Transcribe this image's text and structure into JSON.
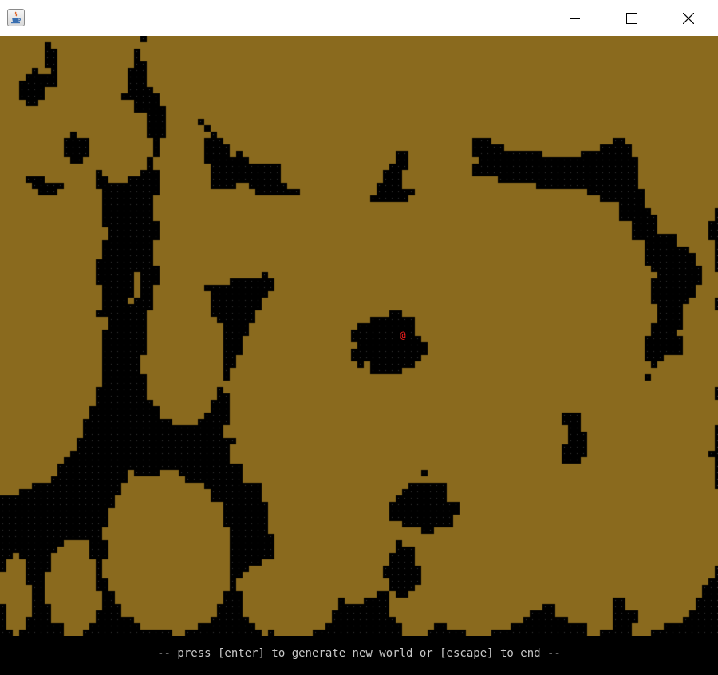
{
  "window": {
    "icons": {
      "app": "java-cup-icon",
      "minimize": "minimize-icon",
      "maximize": "maximize-icon",
      "close": "close-icon"
    }
  },
  "world": {
    "player_glyph": "@",
    "colors": {
      "floor": "#000000",
      "wall": "#8a6a1e",
      "dot": "#3a3a3a",
      "player": "#ff2020",
      "status_text": "#c8c8c8"
    }
  },
  "status": {
    "message": "-- press [enter] to generate new world or [escape] to end --"
  }
}
